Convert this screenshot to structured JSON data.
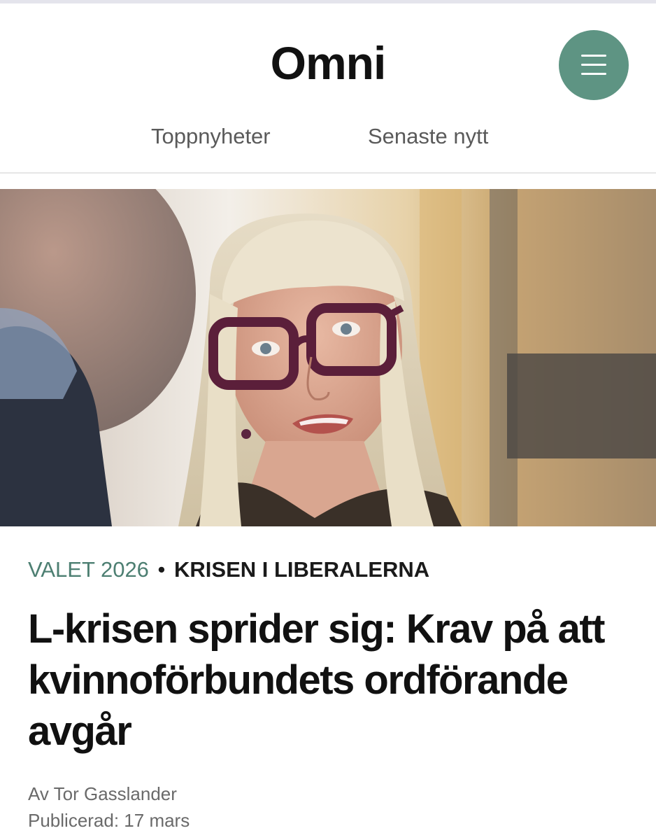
{
  "header": {
    "logo": "Omni",
    "menu_icon": "hamburger-menu-icon",
    "accent_color": "#5e9483"
  },
  "nav": {
    "tabs": [
      {
        "label": "Toppnyheter"
      },
      {
        "label": "Senaste nytt"
      }
    ]
  },
  "article": {
    "image_alt": "",
    "section": "VALET 2026",
    "separator": "•",
    "topic": "KRISEN I LIBERALERNA",
    "headline": "L-krisen sprider sig: Krav på att kvinnoförbundets ordförande avgår",
    "byline": "Av Tor Gasslander",
    "published": "Publicerad: 17 mars",
    "section_color": "#4d7f72"
  }
}
